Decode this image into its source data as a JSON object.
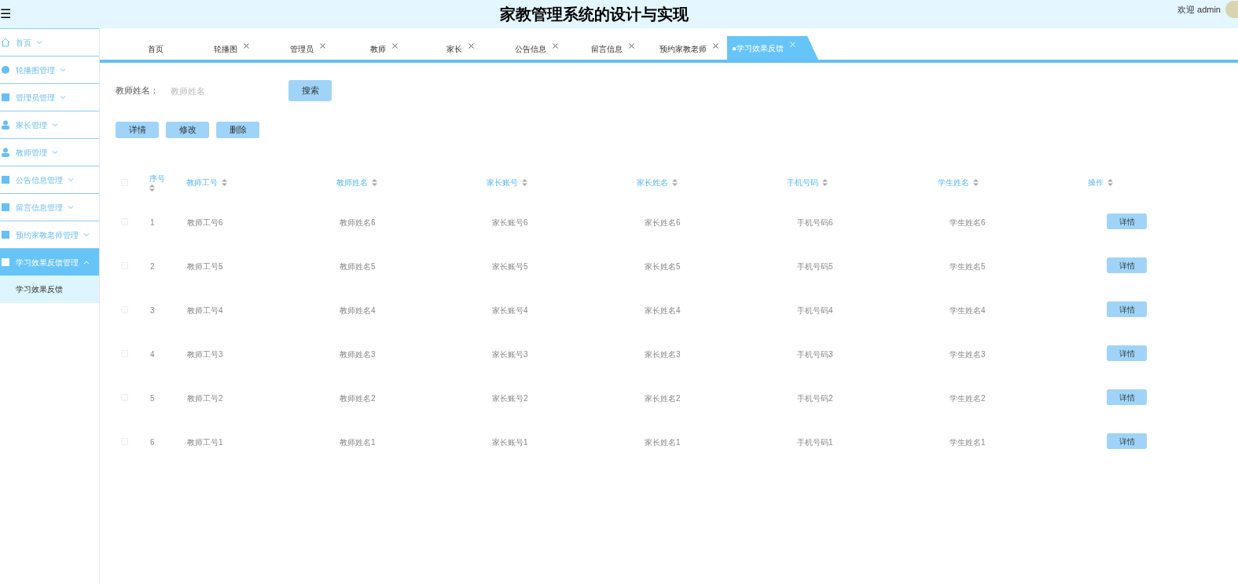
{
  "header": {
    "menu_toggle": "☰",
    "title": "家教管理系统的设计与实现",
    "welcome": "欢迎 admin"
  },
  "sidebar": {
    "items": [
      {
        "label": "首页",
        "expanded": false,
        "selected": false
      },
      {
        "label": "轮播图管理",
        "expanded": false,
        "selected": false
      },
      {
        "label": "管理员管理",
        "expanded": false,
        "selected": false
      },
      {
        "label": "家长管理",
        "expanded": false,
        "selected": false
      },
      {
        "label": "教师管理",
        "expanded": false,
        "selected": false
      },
      {
        "label": "公告信息管理",
        "expanded": false,
        "selected": false
      },
      {
        "label": "留言信息管理",
        "expanded": false,
        "selected": false
      },
      {
        "label": "预约家教老师管理",
        "expanded": false,
        "selected": false
      },
      {
        "label": "学习效果反馈管理",
        "expanded": true,
        "selected": true,
        "children": [
          {
            "label": "学习效果反馈"
          }
        ]
      }
    ]
  },
  "tabs": [
    {
      "label": "首页",
      "closable": false,
      "selected": false
    },
    {
      "label": "轮播图",
      "closable": true,
      "selected": false
    },
    {
      "label": "管理员",
      "closable": true,
      "selected": false
    },
    {
      "label": "教师",
      "closable": true,
      "selected": false
    },
    {
      "label": "家长",
      "closable": true,
      "selected": false
    },
    {
      "label": "公告信息",
      "closable": true,
      "selected": false
    },
    {
      "label": "留言信息",
      "closable": true,
      "selected": false
    },
    {
      "label": "预约家教老师",
      "closable": true,
      "selected": false
    },
    {
      "label": "●学习效果反馈",
      "closable": true,
      "selected": true
    }
  ],
  "search": {
    "label": "教师姓名：",
    "placeholder": "教师姓名",
    "button": "搜索"
  },
  "actions": [
    "详情",
    "修改",
    "删除"
  ],
  "table": {
    "all_checked": false,
    "columns": [
      "序号",
      "教师工号",
      "教师姓名",
      "家长账号",
      "家长姓名",
      "手机号码",
      "学生姓名",
      "操作"
    ],
    "rows": [
      {
        "checked": false,
        "cells": [
          "1",
          "教师工号6",
          "教师姓名6",
          "家长账号6",
          "家长姓名6",
          "手机号码6",
          "学生姓名6"
        ],
        "action": "详情"
      },
      {
        "checked": false,
        "cells": [
          "2",
          "教师工号5",
          "教师姓名5",
          "家长账号5",
          "家长姓名5",
          "手机号码5",
          "学生姓名5"
        ],
        "action": "详情"
      },
      {
        "checked": false,
        "cells": [
          "3",
          "教师工号4",
          "教师姓名4",
          "家长账号4",
          "家长姓名4",
          "手机号码4",
          "学生姓名4"
        ],
        "action": "详情"
      },
      {
        "checked": false,
        "cells": [
          "4",
          "教师工号3",
          "教师姓名3",
          "家长账号3",
          "家长姓名3",
          "手机号码3",
          "学生姓名3"
        ],
        "action": "详情"
      },
      {
        "checked": false,
        "cells": [
          "5",
          "教师工号2",
          "教师姓名2",
          "家长账号2",
          "家长姓名2",
          "手机号码2",
          "学生姓名2"
        ],
        "action": "详情"
      },
      {
        "checked": false,
        "cells": [
          "6",
          "教师工号1",
          "教师姓名1",
          "家长账号1",
          "家长姓名1",
          "手机号码1",
          "学生姓名1"
        ],
        "action": "详情"
      }
    ]
  }
}
